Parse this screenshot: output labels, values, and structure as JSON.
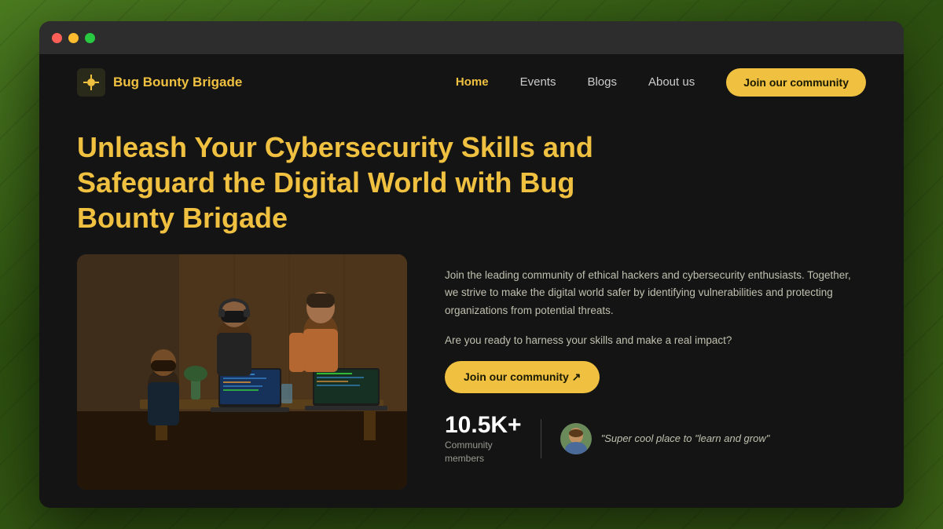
{
  "browser": {
    "traffic_lights": [
      "red",
      "yellow",
      "green"
    ]
  },
  "nav": {
    "logo_icon": "🐛",
    "logo_text": "Bug Bounty Brigade",
    "links": [
      {
        "label": "Home",
        "active": true
      },
      {
        "label": "Events",
        "active": false
      },
      {
        "label": "Blogs",
        "active": false
      },
      {
        "label": "About us",
        "active": false
      }
    ],
    "cta_label": "Join our community"
  },
  "hero": {
    "title": "Unleash Your Cybersecurity Skills and Safeguard the Digital World with Bug Bounty Brigade",
    "description": "Join the leading community of ethical hackers and cybersecurity enthusiasts. Together, we strive to make the digital world safer by identifying vulnerabilities and protecting organizations from potential threats.",
    "question": "Are you ready to harness your skills and make a real impact?",
    "cta_label": "Join our community ↗",
    "stats_number": "10.5K+",
    "stats_label": "Community\nmembers",
    "testimonial_quote": "\"Super cool place to \"learn and grow\""
  }
}
